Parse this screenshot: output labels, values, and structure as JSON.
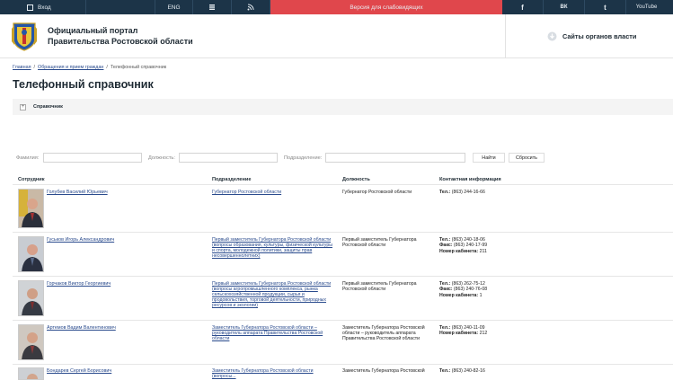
{
  "topbar": {
    "login": "Вход",
    "lang": "ENG",
    "visually_impaired": "Версия для слабовидящих",
    "youtube": "YouTube",
    "vk": "ВК"
  },
  "header": {
    "title_line1": "Официальный портал",
    "title_line2": "Правительства Ростовской области",
    "gov_sites": "Сайты органов власти"
  },
  "breadcrumb": [
    "Главная",
    "Обращения и прием граждан",
    "Телефонный справочник"
  ],
  "page_title": "Телефонный справочник",
  "accordion_label": "Справочник",
  "filters": {
    "surname_label": "Фамилия:",
    "position_label": "Должность:",
    "department_label": "Подразделение:",
    "find": "Найти",
    "reset": "Сбросить"
  },
  "table": {
    "headers": [
      "Сотрудник",
      "Подразделение",
      "Должность",
      "Контактная информация"
    ],
    "rows": [
      {
        "name": "Голубев Василий Юрьевич",
        "dept": "Губернатор Ростовской области",
        "pos": "Губернатор Ростовской области",
        "tel_label": "Тел.:",
        "tel": "(863) 244-16-66",
        "photo_color": "#6d4a3a"
      },
      {
        "name": "Гуськов Игорь Александрович",
        "dept": "Первый заместитель Губернатора Ростовской области (вопросы образования, культуры, физической культуры и спорта, молодежной политики, защиты прав несовершеннолетних)",
        "pos": "Первый заместитель Губернатора Ростовской области",
        "tel_label": "Тел.:",
        "tel": "(863) 240-18-06",
        "fax_label": "Факс:",
        "fax": "(863) 240-17-99",
        "room_label": "Номер кабинета:",
        "room": "211",
        "photo_color": "#4c5a6c"
      },
      {
        "name": "Горчаков Виктор Георгиевич",
        "dept": "Первый заместитель Губернатора Ростовской области (вопросы агропромышленного комплекса, рынка сельскохозяйственной продукции, сырья и продовольствия, торговой деятельности, природных ресурсов и экологии)",
        "pos": "Первый заместитель Губернатора Ростовской области",
        "tel_label": "Тел.:",
        "tel": "(863) 262-75-12",
        "fax_label": "Факс:",
        "fax": "(863) 240-76-08",
        "room_label": "Номер кабинета:",
        "room": "1",
        "photo_color": "#55606b"
      },
      {
        "name": "Артемов Вадим Валентинович",
        "dept": "Заместитель Губернатора Ростовской области – руководитель аппарата Правительства Ростовской области",
        "pos": "Заместитель Губернатора Ростовской области – руководитель аппарата Правительства Ростовской области",
        "tel_label": "Тел.:",
        "tel": "(863) 240-11-09",
        "room_label": "Номер кабинета:",
        "room": "212",
        "photo_color": "#6b5a4c"
      },
      {
        "name": "Бондарев Сергей Борисович",
        "dept": "Заместитель Губернатора Ростовской области (вопросы...",
        "pos": "Заместитель Губернатора Ростовской",
        "tel_label": "Тел.:",
        "tel": "(863) 240-82-16",
        "photo_color": "#5a5f66"
      }
    ]
  }
}
